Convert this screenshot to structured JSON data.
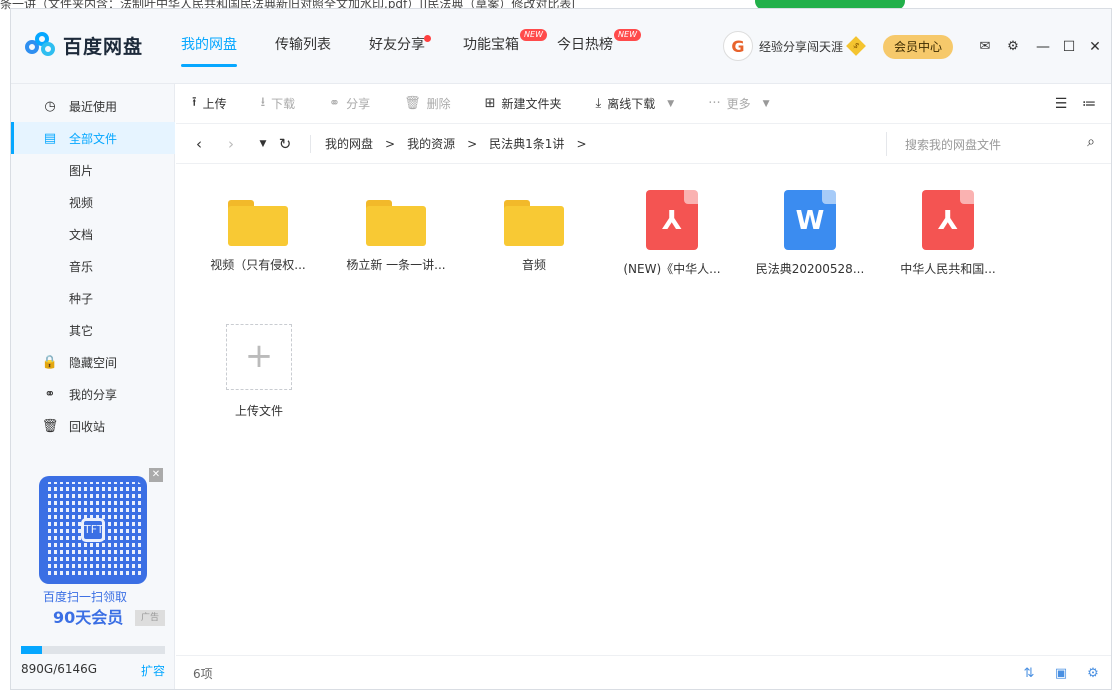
{
  "bg_title": "条一讲（文件夹内含：法制叶中华人民共和国民法典新旧对照全文加水印.pdf）||民法典（草案）修改对比表|",
  "logo": {
    "text": "百度网盘"
  },
  "nav": [
    {
      "label": "我的网盘",
      "active": true
    },
    {
      "label": "传输列表"
    },
    {
      "label": "好友分享"
    },
    {
      "label": "功能宝箱",
      "badge": "NEW"
    },
    {
      "label": "今日热榜",
      "badge": "NEW"
    }
  ],
  "user": {
    "name": "经验分享闯天涯",
    "avatar": "G"
  },
  "vip_label": "会员中心",
  "sidebar": {
    "items": [
      {
        "label": "最近使用",
        "icon": "◷"
      },
      {
        "label": "全部文件",
        "icon": "▤"
      },
      {
        "label": "图片"
      },
      {
        "label": "视频"
      },
      {
        "label": "文档"
      },
      {
        "label": "音乐"
      },
      {
        "label": "种子"
      },
      {
        "label": "其它"
      },
      {
        "label": "隐藏空间",
        "icon": "🔒"
      },
      {
        "label": "我的分享",
        "icon": "⚭"
      },
      {
        "label": "回收站",
        "icon": "🗑"
      }
    ],
    "promo": {
      "line1": "百度扫一扫领取",
      "line2": "90天会员",
      "ad": "广告",
      "qr_center": "TFT"
    },
    "quota": {
      "text": "890G/6146G",
      "expand": "扩容",
      "fraction": 0.145
    }
  },
  "toolbar": {
    "upload": "上传",
    "download": "下载",
    "share": "分享",
    "delete": "删除",
    "new_folder": "新建文件夹",
    "offline": "离线下载",
    "more": "更多"
  },
  "path": {
    "crumbs": [
      "我的网盘",
      "我的资源",
      "民法典1条1讲"
    ],
    "search_placeholder": "搜索我的网盘文件"
  },
  "files": [
    {
      "name": "视频（只有侵权...",
      "type": "folder"
    },
    {
      "name": "杨立新 一条一讲...",
      "type": "folder"
    },
    {
      "name": "音频",
      "type": "folder"
    },
    {
      "name": "(NEW)《中华人...",
      "type": "pdf"
    },
    {
      "name": "民法典20200528...",
      "type": "word"
    },
    {
      "name": "中华人民共和国...",
      "type": "pdf"
    }
  ],
  "upload_tile": "上传文件",
  "status": {
    "count": "6项"
  }
}
